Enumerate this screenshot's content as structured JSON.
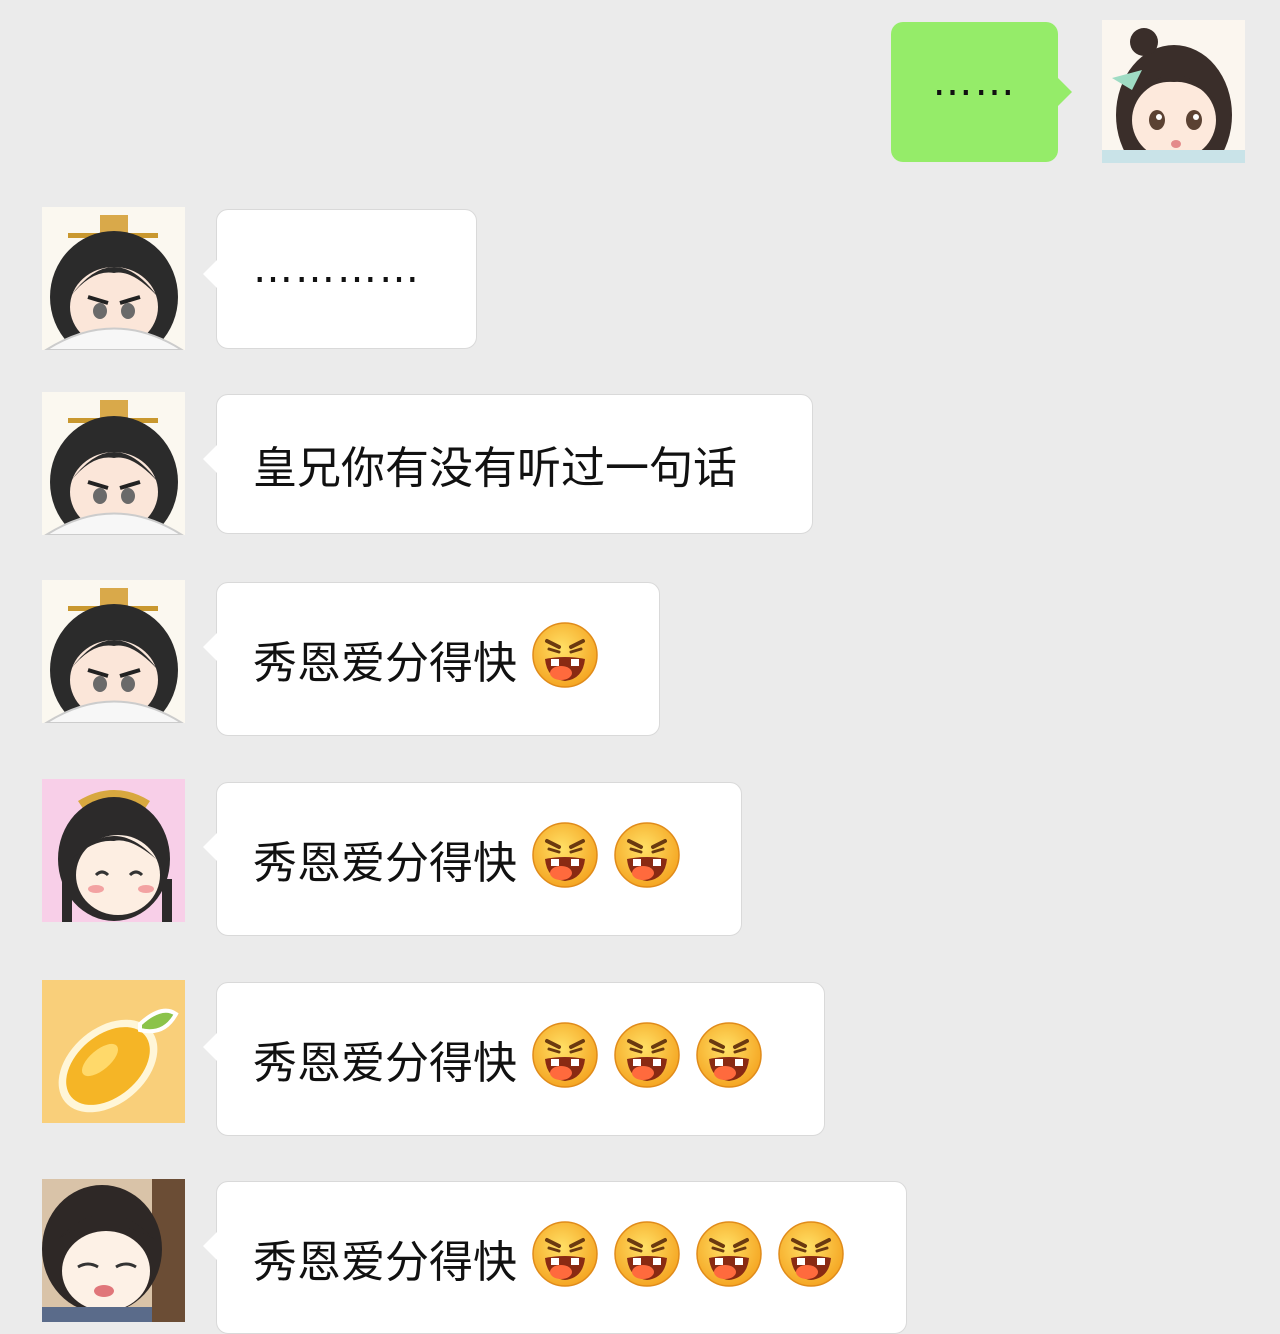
{
  "chat": {
    "messages": [
      {
        "sender": "self",
        "text": "……"
      },
      {
        "sender": "brother",
        "text": "…………"
      },
      {
        "sender": "brother",
        "text": "皇兄你有没有听过一句话"
      },
      {
        "sender": "brother",
        "text": "秀恩爱分得快",
        "emoji_count": 1
      },
      {
        "sender": "lady",
        "text": "秀恩爱分得快",
        "emoji_count": 2
      },
      {
        "sender": "lemon",
        "text": "秀恩爱分得快",
        "emoji_count": 3
      },
      {
        "sender": "sleepy",
        "text": "秀恩爱分得快",
        "emoji_count": 4
      }
    ],
    "emoji_name": "grimace-tongue-emoji",
    "colors": {
      "background": "#ebebeb",
      "outgoing_bubble": "#95ec69",
      "incoming_bubble": "#ffffff"
    }
  }
}
